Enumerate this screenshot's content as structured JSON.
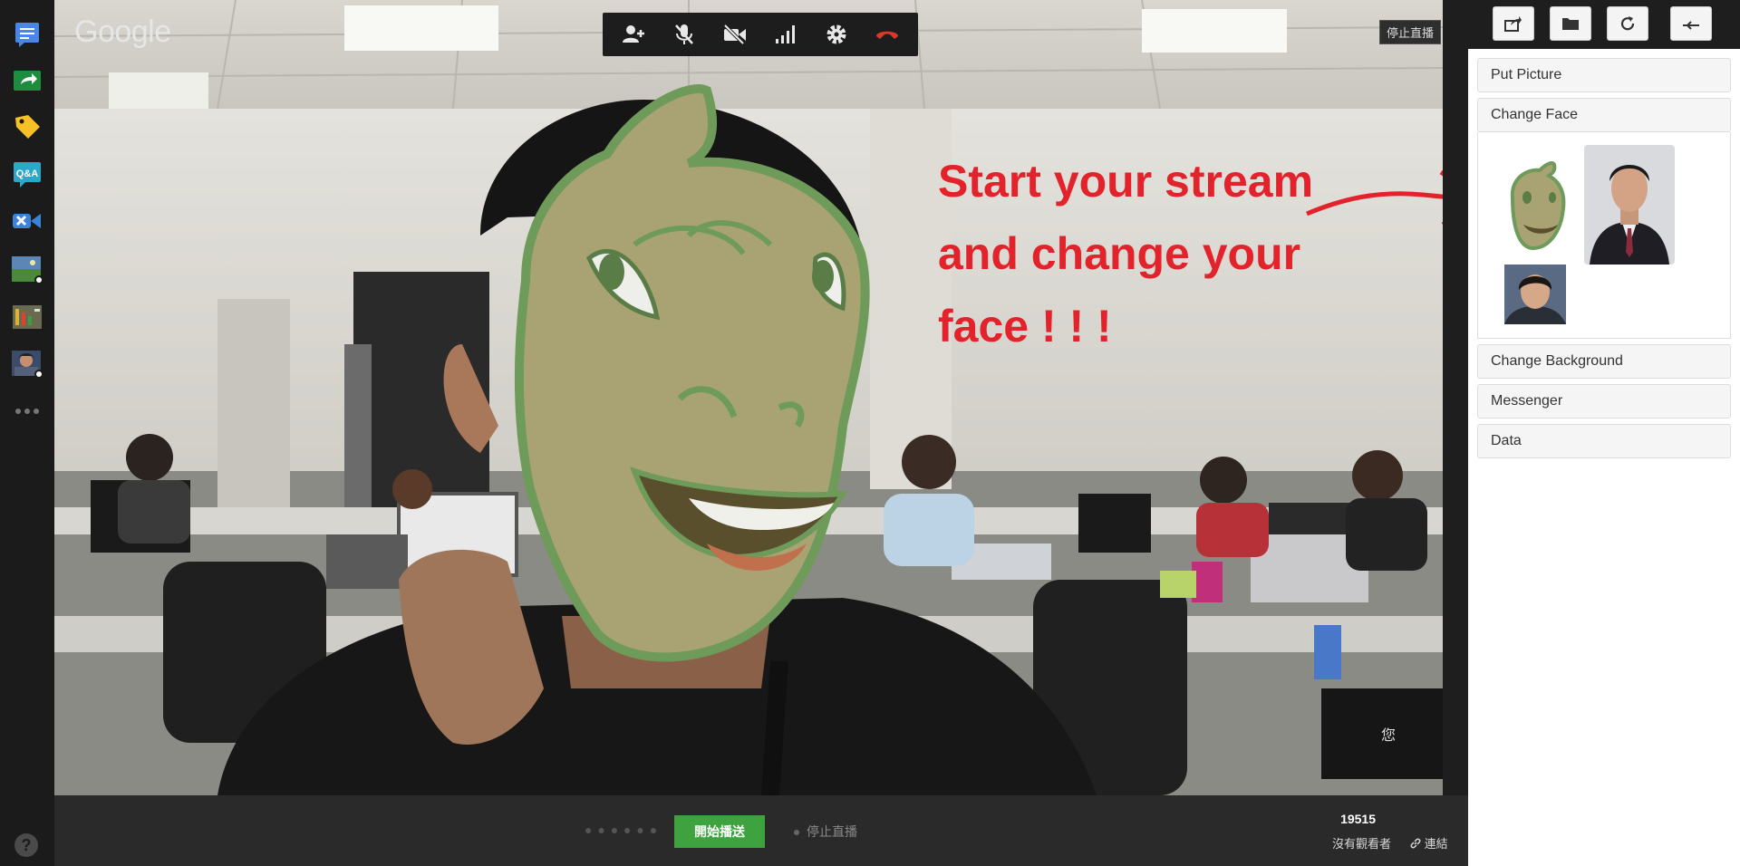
{
  "app": {
    "brand": "Google"
  },
  "rail": {
    "items": [
      "chat-icon",
      "screenshare-icon",
      "label-icon",
      "qa-icon",
      "toolbox-icon",
      "effects-icon",
      "control-room-icon",
      "facechange-icon",
      "more-icon"
    ],
    "help": "?"
  },
  "toolbar": {
    "buttons": [
      "invite-icon",
      "mic-off-icon",
      "camera-off-icon",
      "bandwidth-icon",
      "settings-icon",
      "hangup-icon"
    ]
  },
  "stage": {
    "stop_badge": "停止直播",
    "annotation_lines": [
      "Start your stream",
      "and change your",
      "face ! ! !"
    ],
    "self_label": "您"
  },
  "bottombar": {
    "loading_dots": "● ● ● ● ● ●",
    "start_button": "開始播送",
    "stop_link": "停止直播",
    "viewer_count": "19515",
    "viewers_text": "沒有觀看者",
    "link_text": "連結"
  },
  "panel": {
    "top_buttons": [
      "share-icon",
      "folder-icon",
      "refresh-icon",
      "back-icon"
    ],
    "sections": [
      "Put Picture",
      "Change Face",
      "Change Background",
      "Messenger",
      "Data"
    ]
  },
  "colors": {
    "annotation": "#e3232b",
    "start_button": "#3ea33e",
    "hangup": "#d9392b",
    "lizard_face": "#a9a374",
    "lizard_outline": "#6e9a5a"
  }
}
